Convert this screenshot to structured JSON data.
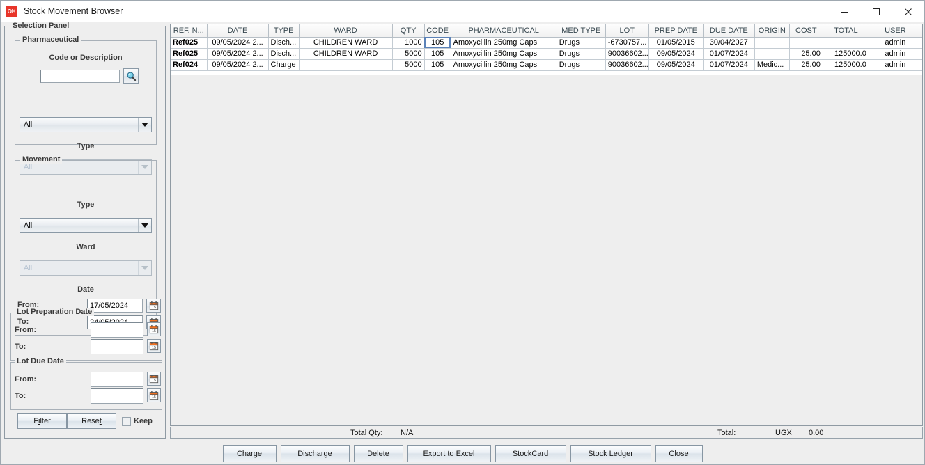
{
  "window": {
    "logo_text": "OH",
    "title": "Stock Movement Browser",
    "minimize_icon": "—",
    "maximize_icon": "☐",
    "close_icon": "✕"
  },
  "selection_panel": {
    "title": "Selection Panel",
    "pharmaceutical": {
      "title": "Pharmaceutical",
      "code_label": "Code or Description",
      "code_value": "",
      "code_placeholder": "",
      "search_icon": "search-icon",
      "pharmaceutical_combo_value": "All",
      "type_label": "Type",
      "type_combo_value": "All",
      "type_combo_disabled": true
    },
    "movement": {
      "title": "Movement",
      "type_label": "Type",
      "type_combo_value": "All",
      "ward_label": "Ward",
      "ward_combo_value": "All",
      "ward_combo_disabled": true,
      "date_label": "Date",
      "from_label": "From:",
      "from_value": "17/05/2024",
      "to_label": "To:",
      "to_value": "24/05/2024",
      "calendar_icon": "calendar-icon",
      "calendar_icon_day": "15"
    },
    "lot_preparation_date": {
      "title": "Lot Preparation Date",
      "from_label": "From:",
      "from_value": "",
      "to_label": "To:",
      "to_value": ""
    },
    "lot_due_date": {
      "title": "Lot Due Date",
      "from_label": "From:",
      "from_value": "",
      "to_label": "To:",
      "to_value": ""
    },
    "actions": {
      "filter_pre": "F",
      "filter_mn": "i",
      "filter_post": "lter",
      "reset_pre": "Rese",
      "reset_mn": "t",
      "reset_post": "",
      "keep_label": "Keep",
      "keep_checked": false
    }
  },
  "table": {
    "columns": [
      "REF. N...",
      "DATE",
      "TYPE",
      "WARD",
      "QTY",
      "CODE",
      "PHARMACEUTICAL",
      "MED TYPE",
      "LOT",
      "PREP DATE",
      "DUE DATE",
      "ORIGIN",
      "COST",
      "TOTAL",
      "USER"
    ],
    "rows": [
      {
        "ref": "Ref025",
        "date": "09/05/2024 2...",
        "type": "Disch...",
        "ward": "CHILDREN WARD",
        "qty": "1000",
        "code": "105",
        "pharmaceutical": "Amoxycillin 250mg Caps",
        "med_type": "Drugs",
        "lot": "-6730757...",
        "prep_date": "01/05/2015",
        "due_date": "30/04/2027",
        "origin": "",
        "cost": "",
        "total": "",
        "user": "admin"
      },
      {
        "ref": "Ref025",
        "date": "09/05/2024 2...",
        "type": "Disch...",
        "ward": "CHILDREN WARD",
        "qty": "5000",
        "code": "105",
        "pharmaceutical": "Amoxycillin 250mg Caps",
        "med_type": "Drugs",
        "lot": "90036602...",
        "prep_date": "09/05/2024",
        "due_date": "01/07/2024",
        "origin": "",
        "cost": "25.00",
        "total": "125000.0",
        "user": "admin"
      },
      {
        "ref": "Ref024",
        "date": "09/05/2024 2...",
        "type": "Charge",
        "ward": "",
        "qty": "5000",
        "code": "105",
        "pharmaceutical": "Amoxycillin 250mg Caps",
        "med_type": "Drugs",
        "lot": "90036602...",
        "prep_date": "09/05/2024",
        "due_date": "01/07/2024",
        "origin": "Medic...",
        "cost": "25.00",
        "total": "125000.0",
        "user": "admin"
      }
    ]
  },
  "status_bar": {
    "total_qty_label": "Total Qty:",
    "total_qty_value": "N/A",
    "total_label": "Total:",
    "currency": "UGX",
    "total_value": "0.00"
  },
  "bottom_buttons": [
    {
      "pre": "C",
      "mn": "h",
      "post": "arge",
      "name": "charge-button"
    },
    {
      "pre": "Discha",
      "mn": "r",
      "post": "ge",
      "name": "discharge-button"
    },
    {
      "pre": "D",
      "mn": "e",
      "post": "lete",
      "name": "delete-button"
    },
    {
      "pre": "E",
      "mn": "x",
      "post": "port to Excel",
      "name": "export-to-excel-button"
    },
    {
      "pre": "StockC",
      "mn": "a",
      "post": "rd",
      "name": "stockcard-button"
    },
    {
      "pre": "Stock L",
      "mn": "e",
      "post": "dger",
      "name": "stock-ledger-button"
    },
    {
      "pre": "C",
      "mn": "l",
      "post": "ose",
      "name": "close-button"
    }
  ]
}
